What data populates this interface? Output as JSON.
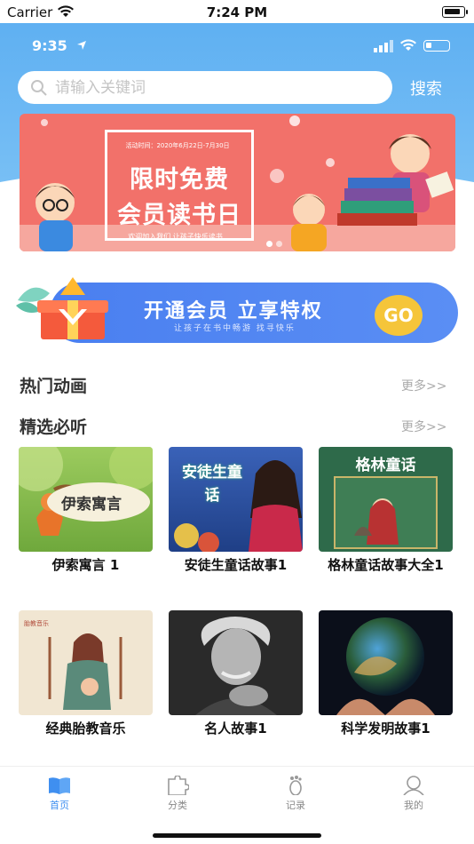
{
  "sim_status": {
    "carrier": "Carrier",
    "time": "7:24 PM"
  },
  "app_status": {
    "time": "9:35"
  },
  "search": {
    "placeholder": "请输入关键词",
    "button": "搜索"
  },
  "banner": {
    "date": "活动时间：2020年6月22日-7月30日",
    "title_line1": "限时免费",
    "title_line2": "会员读书日",
    "tagline": "欢迎加入我们  让孩子快乐读书"
  },
  "vip": {
    "title": "开通会员  立享特权",
    "subtitle": "让孩子在书中畅游  找寻快乐",
    "go": "GO"
  },
  "sections": [
    {
      "title": "热门动画",
      "more": "更多>>"
    },
    {
      "title": "精选必听",
      "more": "更多>>"
    }
  ],
  "cards": [
    {
      "label": "伊索寓言 1",
      "thumb_text": "伊索寓言"
    },
    {
      "label": "安徒生童话故事1",
      "thumb_text": "安徒生童话"
    },
    {
      "label": "格林童话故事大全1",
      "thumb_text": "格林童话"
    },
    {
      "label": "经典胎教音乐",
      "thumb_text": "胎教音乐"
    },
    {
      "label": "名人故事1"
    },
    {
      "label": "科学发明故事1"
    }
  ],
  "tabs": [
    {
      "label": "首页",
      "icon": "book-icon",
      "active": true
    },
    {
      "label": "分类",
      "icon": "puzzle-icon",
      "active": false
    },
    {
      "label": "记录",
      "icon": "footprint-icon",
      "active": false
    },
    {
      "label": "我的",
      "icon": "user-icon",
      "active": false
    }
  ],
  "colors": {
    "header": "#5fb0f2",
    "banner": "#f2716a",
    "vip": "#4a7ff0",
    "tab_active": "#3f8ff0"
  }
}
